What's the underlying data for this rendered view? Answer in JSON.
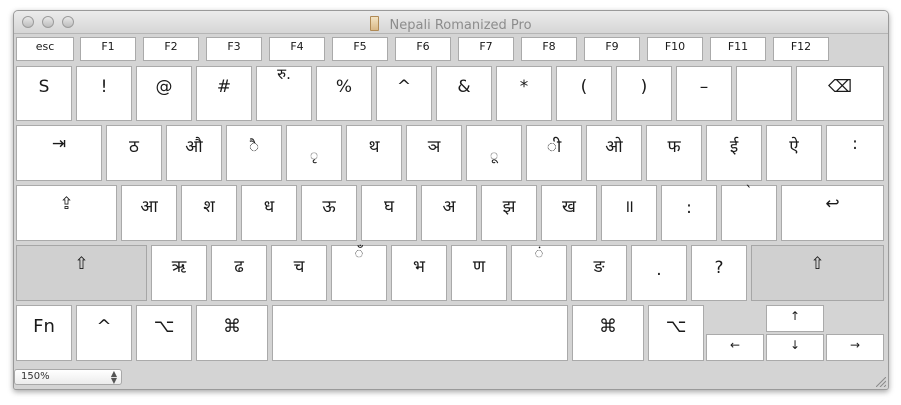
{
  "window": {
    "title": "Nepali Romanized Pro"
  },
  "function_row": [
    "esc",
    "F1",
    "F2",
    "F3",
    "F4",
    "F5",
    "F6",
    "F7",
    "F8",
    "F9",
    "F10",
    "F11",
    "F12"
  ],
  "row1": [
    "S",
    "!",
    "@",
    "#",
    "रु.",
    "%",
    "^",
    "&",
    "*",
    "(",
    ")",
    "–",
    "",
    "⌫"
  ],
  "row2": [
    "⇥",
    "ठ",
    "औ",
    "ै",
    "ृ",
    "थ",
    "ञ",
    "ू",
    "ी",
    "ओ",
    "फ",
    "ई",
    "ऐ",
    ":"
  ],
  "row3": [
    "⇪",
    "आ",
    "श",
    "ध",
    "ऊ",
    "घ",
    "अ",
    "झ",
    "ख",
    "॥",
    ":",
    "`",
    "↩"
  ],
  "row4": [
    "⇧",
    "ऋ",
    "ढ",
    "च",
    "ँ",
    "भ",
    "ण",
    "ं",
    "ङ",
    ".",
    "?",
    "⇧"
  ],
  "row5": [
    "Fn",
    "^",
    "⌥",
    "⌘",
    "",
    "⌘",
    "⌥"
  ],
  "arrows": {
    "up": "↑",
    "left": "←",
    "down": "↓",
    "right": "→"
  },
  "status": {
    "zoom": "150%"
  },
  "icons": {
    "arrows": "up-down-chevron-icon",
    "grip": "resize-grip-icon",
    "app": "keyboard-layout-file-icon"
  },
  "colors": {
    "key_bg": "#ffffff",
    "modifier_bg": "#d0d0d0",
    "window_bg": "#d4d4d4"
  }
}
